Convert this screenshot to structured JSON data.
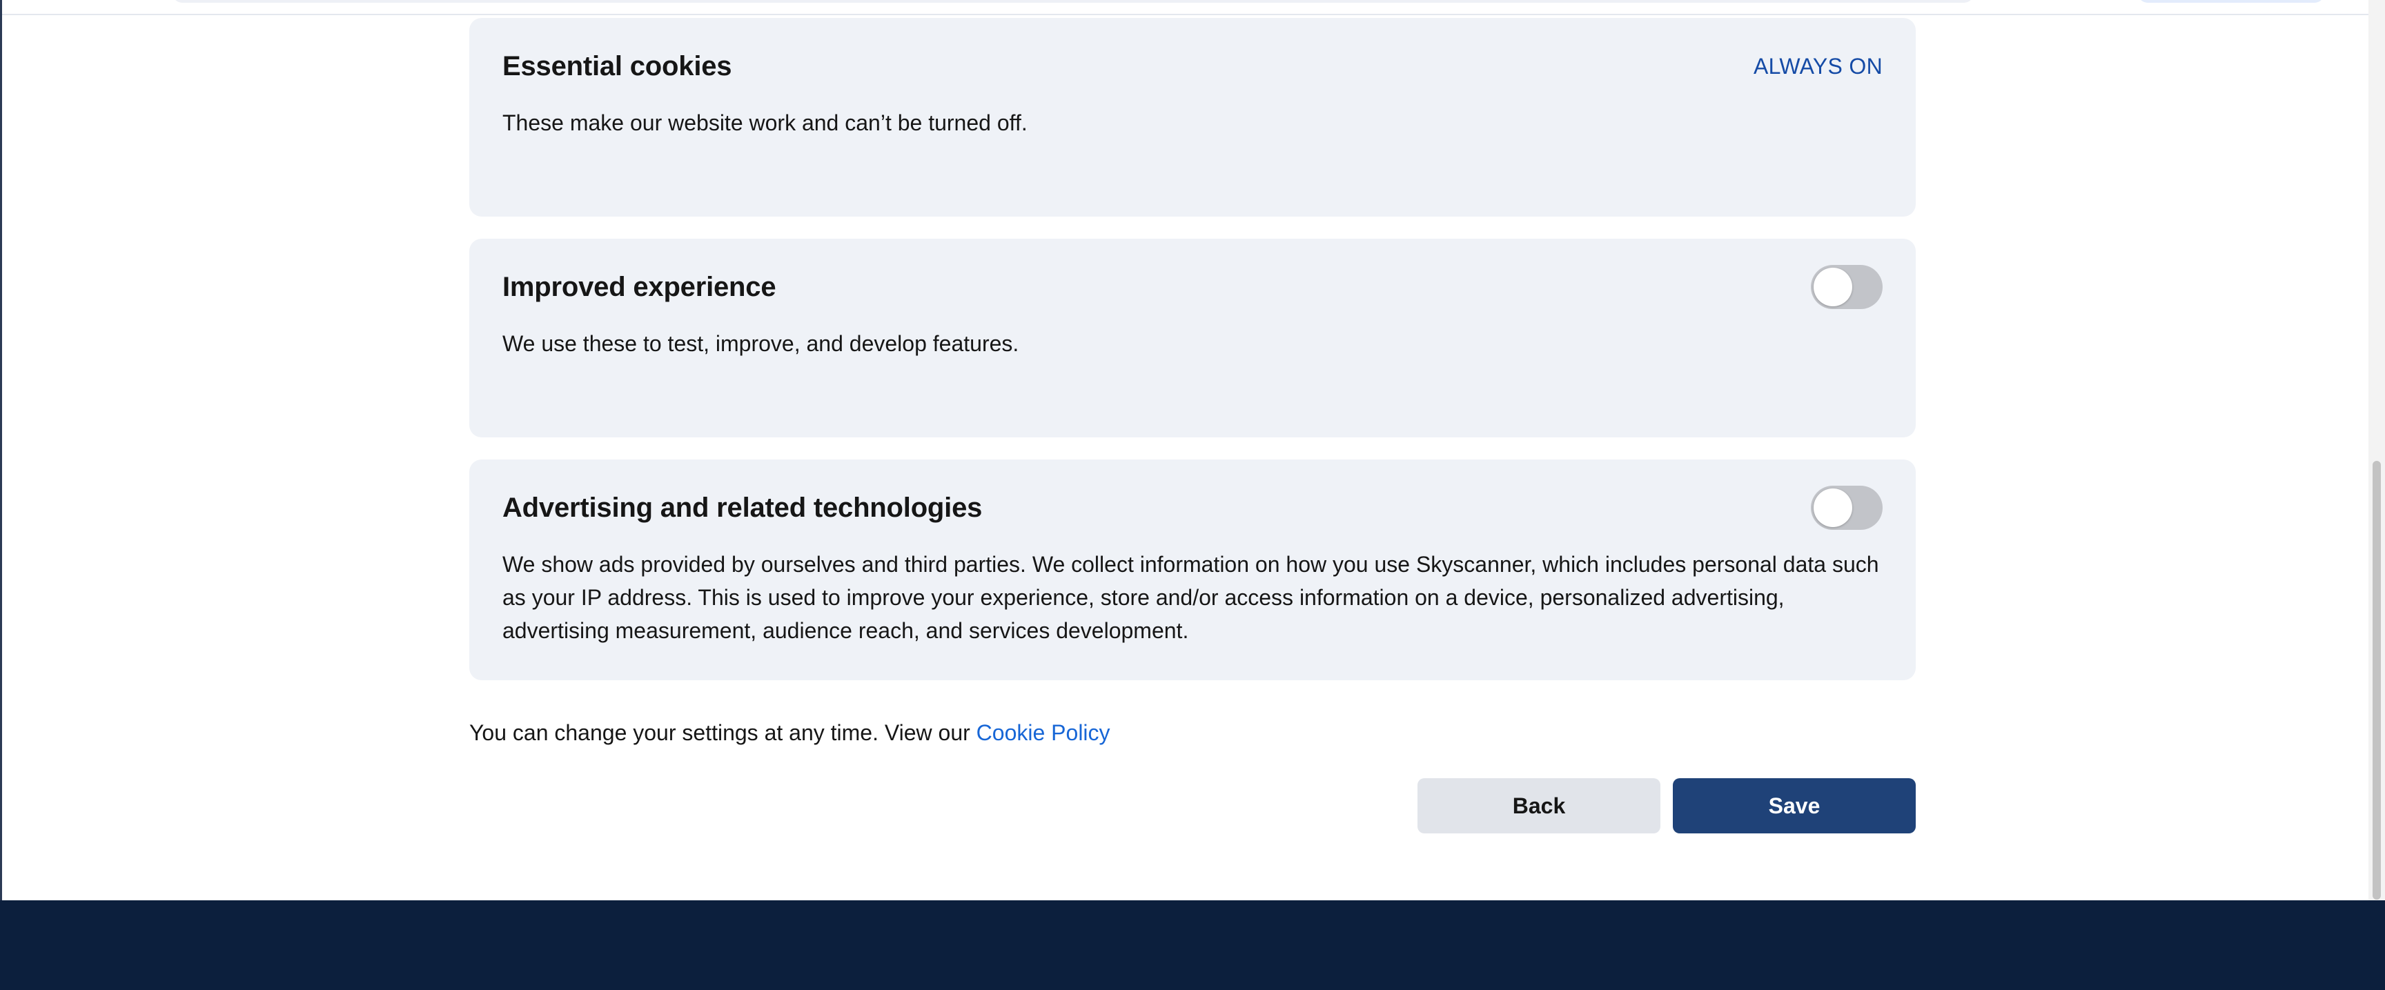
{
  "cookie_settings": {
    "sections": [
      {
        "title": "Essential cookies",
        "status": "ALWAYS ON",
        "description": "These make our website work and can’t be turned off."
      },
      {
        "title": "Improved experience",
        "toggle_on": false,
        "description": "We use these to test, improve, and develop features."
      },
      {
        "title": "Advertising and related technologies",
        "toggle_on": false,
        "description": "We show ads provided by ourselves and third parties. We collect information on how you use Skyscanner, which includes personal data such as your IP address. This is used to improve your experience, store and/or access information on a device, personalized advertising, advertising measurement, audience reach, and services development."
      }
    ],
    "footer_note": "You can change your settings at any time. View our",
    "policy_link": "Cookie Policy",
    "back_label": "Back",
    "save_label": "Save"
  },
  "colors": {
    "card_bg": "#eff2f7",
    "accent_link": "#1766d6",
    "save_button_bg": "#1f4278",
    "footer_bg": "#0c1f3d"
  }
}
